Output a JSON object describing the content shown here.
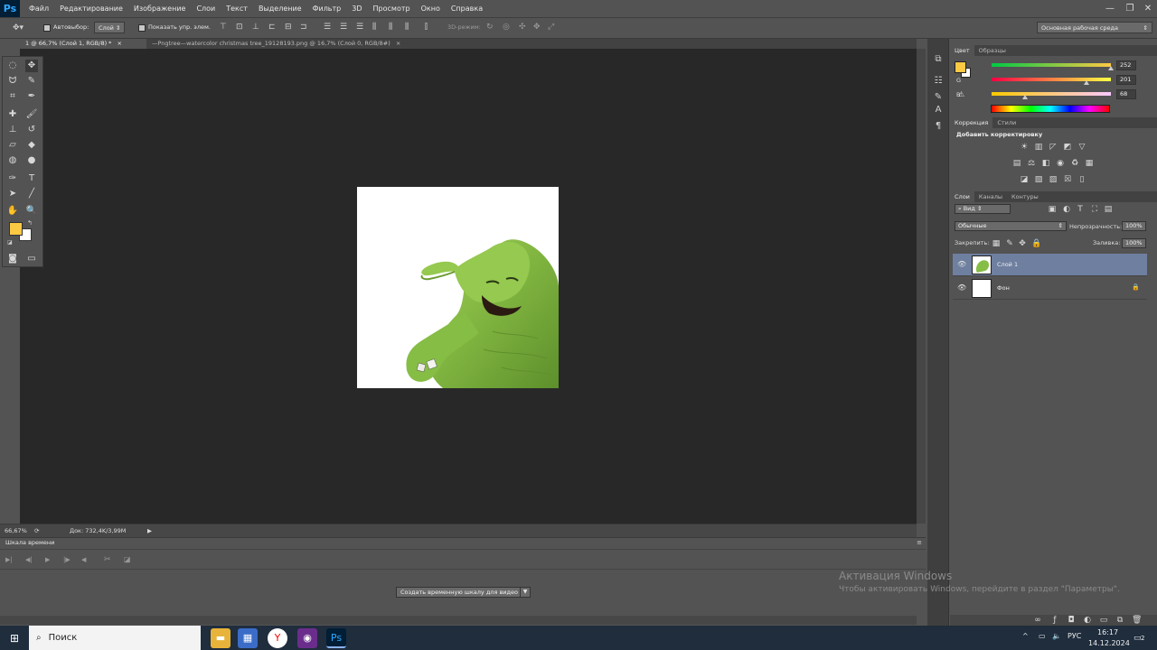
{
  "app": {
    "name": "Ps"
  },
  "menu": [
    "Файл",
    "Редактирование",
    "Изображение",
    "Слои",
    "Текст",
    "Выделение",
    "Фильтр",
    "3D",
    "Просмотр",
    "Окно",
    "Справка"
  ],
  "window_controls": [
    "—",
    "❐",
    "✕"
  ],
  "options": {
    "autoselect_label": "Автовыбор:",
    "autoselect_value": "Слой",
    "show_transform_label": "Показать упр. элем.",
    "mode_3d_label": "3D-режим:",
    "workspace": "Основная рабочая среда"
  },
  "tabs": [
    {
      "label": "1 @ 66,7% (Слой 1, RGB/8) *",
      "close": "×",
      "active": true
    },
    {
      "label": "—Pngtree—watercolor christmas tree_19128193.png @ 16,7% (Слой 0, RGB/8#)",
      "close": "×",
      "active": false
    }
  ],
  "status": {
    "zoom": "66,67%",
    "doc_size": "Док: 732,4K/3,99M"
  },
  "timeline": {
    "tab": "Шкала времени",
    "create_button": "Создать временную шкалу для видео"
  },
  "color_panel": {
    "tabs": [
      "Цвет",
      "Образцы"
    ],
    "r_label": "R",
    "g_label": "G",
    "b_label": "B",
    "r": "252",
    "g": "201",
    "b": "68",
    "foreground": "#fcc944",
    "background": "#ffffff"
  },
  "adjust_panel": {
    "tabs": [
      "Коррекция",
      "Стили"
    ],
    "title": "Добавить корректировку"
  },
  "layers_panel": {
    "tabs": [
      "Слои",
      "Каналы",
      "Контуры"
    ],
    "filter": "Вид",
    "blend_mode": "Обычные",
    "opacity_label": "Непрозрачность:",
    "opacity": "100%",
    "lock_label": "Закрепить:",
    "fill_label": "Заливка:",
    "fill": "100%",
    "layers": [
      {
        "name": "Слой 1",
        "selected": true
      },
      {
        "name": "Фон",
        "selected": false
      }
    ]
  },
  "activation": {
    "title": "Активация Windows",
    "subtitle": "Чтобы активировать Windows, перейдите в раздел \"Параметры\"."
  },
  "taskbar": {
    "search": "Поиск",
    "lang": "РУС",
    "time": "16:17",
    "date": "14.12.2024",
    "notif": "2"
  }
}
